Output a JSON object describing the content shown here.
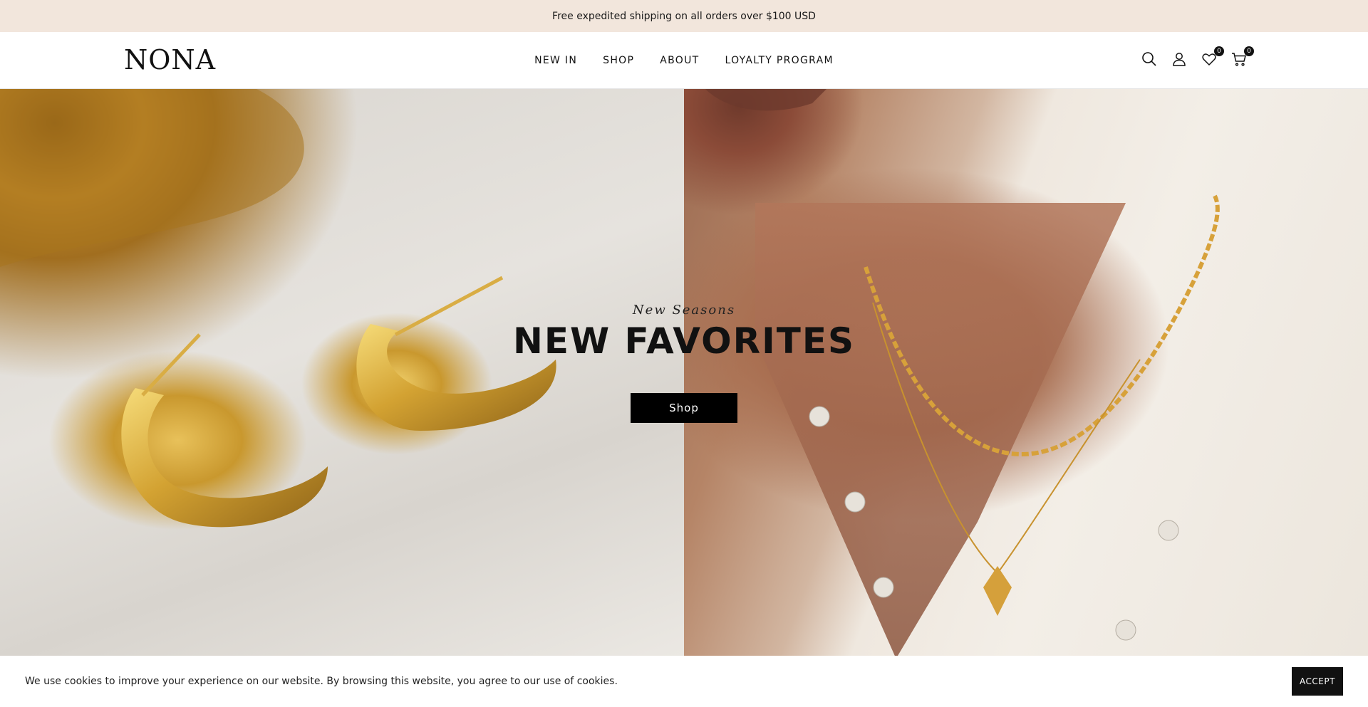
{
  "announcement": {
    "text": "Free expedited shipping on all orders over $100 USD"
  },
  "header": {
    "logo": "NONA",
    "nav": [
      "NEW IN",
      "SHOP",
      "ABOUT",
      "LOYALTY PROGRAM"
    ],
    "icons": {
      "search": "search-icon",
      "account": "user-icon",
      "wishlist": "heart-icon",
      "cart": "cart-icon"
    },
    "wishlist_count": "0",
    "cart_count": "0"
  },
  "hero": {
    "eyebrow": "New Seasons",
    "headline": "NEW FAVORITES",
    "button": "Shop"
  },
  "cookie": {
    "text": "We use cookies to improve your experience on our website. By browsing this website, you agree to our use of cookies.",
    "accept": "ACCEPT"
  },
  "colors": {
    "announcement_bg": "#f2e6dc",
    "button_bg": "#000000"
  }
}
